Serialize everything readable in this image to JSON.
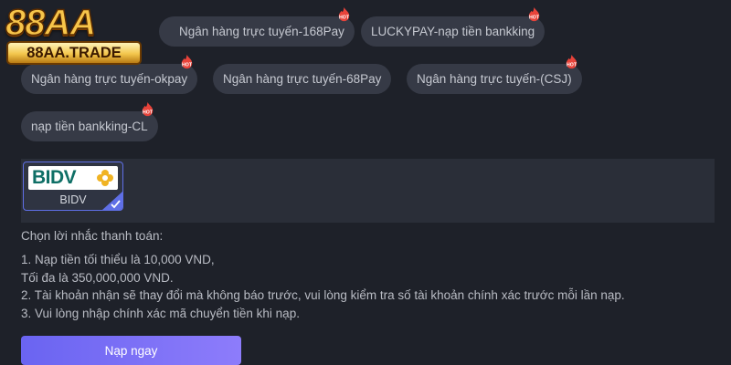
{
  "logo": {
    "big_text": "88AA",
    "small_text": "88AA.TRADE"
  },
  "channels": [
    {
      "label": "Ngân hàng trực tuyến-168Pay",
      "badge": "HOT"
    },
    {
      "label": "LUCKYPAY-nạp tiền bankking",
      "badge": "HOT"
    },
    {
      "label": "Ngân hàng trực tuyến-okpay",
      "badge": "HOT"
    },
    {
      "label": "Ngân hàng trực tuyến-68Pay",
      "badge": ""
    },
    {
      "label": "Ngân hàng trực tuyến-(CSJ)",
      "badge": "HOT"
    },
    {
      "label": "nạp tiền bankking-CL",
      "badge": "HOT"
    }
  ],
  "bank": {
    "logo_text": "BIDV",
    "name": "BIDV",
    "selected": true,
    "brand_color": "#0f6f66",
    "accent_color": "#f0b323"
  },
  "notes": {
    "title": "Chọn lời nhắc thanh toán:",
    "lines": [
      "1. Nạp tiền tối thiểu là 10,000 VND,",
      "Tối đa là 350,000,000 VND.",
      "2. Tài khoản nhận sẽ thay đổi mà không báo trước, vui lòng kiểm tra số tài khoản chính xác trước mỗi lần nạp.",
      "3. Vui lòng nhập chính xác mã chuyển tiền khi nạp."
    ]
  },
  "submit_label": "Nạp ngay",
  "colors": {
    "background": "#1e2129",
    "chip": "#363a46",
    "button_start": "#6a64f1",
    "button_end": "#8d7cfb",
    "hot_badge": "#e8433a"
  }
}
